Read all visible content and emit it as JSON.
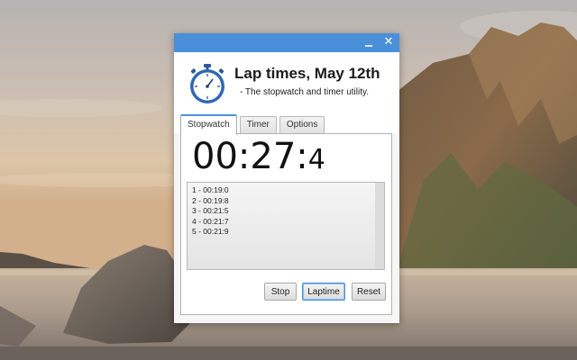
{
  "window": {
    "minimize_glyph": "",
    "close_glyph": "✕",
    "title": "Lap times, May 12th",
    "subtitle": "- The stopwatch and timer utility.",
    "icon": "stopwatch-icon",
    "accent_color": "#4a90d9"
  },
  "tabs": [
    {
      "label": "Stopwatch",
      "active": true
    },
    {
      "label": "Timer",
      "active": false
    },
    {
      "label": "Options",
      "active": false
    }
  ],
  "stopwatch": {
    "time_main": "00:27:",
    "time_tenths": "4",
    "laps": [
      "1 - 00:19:0",
      "2 - 00:19:8",
      "3 - 00:21:5",
      "4 - 00:21:7",
      "5 - 00:21:9"
    ],
    "buttons": {
      "stop": "Stop",
      "laptime": "Laptime",
      "reset": "Reset"
    }
  }
}
